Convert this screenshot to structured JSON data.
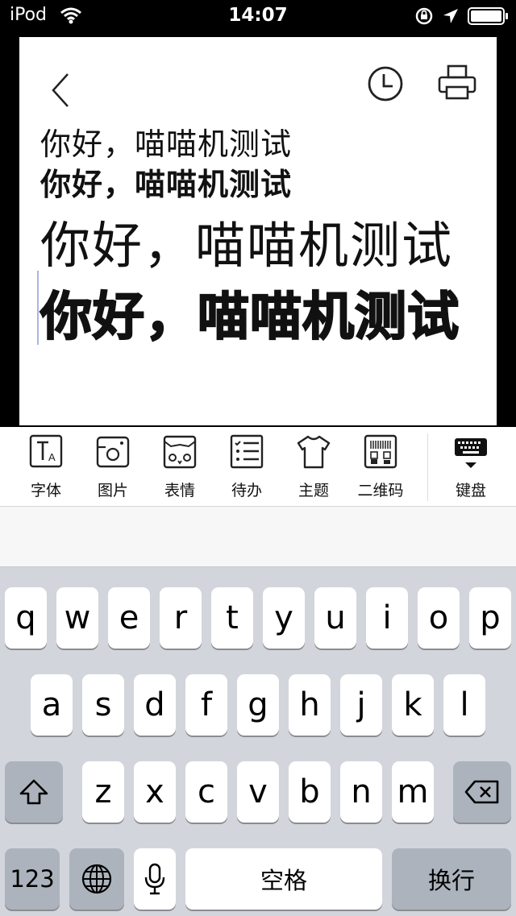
{
  "status_bar": {
    "carrier": "iPod",
    "time": "14:07"
  },
  "note": {
    "lines": [
      "你好，喵喵机测试",
      "你好，喵喵机测试",
      "你好，喵喵机测试",
      "你好，喵喵机测试"
    ]
  },
  "toolbar": {
    "items": [
      {
        "label": "字体",
        "icon": "font-icon"
      },
      {
        "label": "图片",
        "icon": "image-icon"
      },
      {
        "label": "表情",
        "icon": "emoji-cat-icon"
      },
      {
        "label": "待办",
        "icon": "todo-list-icon"
      },
      {
        "label": "主题",
        "icon": "tshirt-theme-icon"
      },
      {
        "label": "二维码",
        "icon": "qrcode-icon"
      },
      {
        "label": "键盘",
        "icon": "keyboard-hide-icon"
      }
    ]
  },
  "keyboard": {
    "row1": [
      "q",
      "w",
      "e",
      "r",
      "t",
      "y",
      "u",
      "i",
      "o",
      "p"
    ],
    "row2": [
      "a",
      "s",
      "d",
      "f",
      "g",
      "h",
      "j",
      "k",
      "l"
    ],
    "row3": [
      "z",
      "x",
      "c",
      "v",
      "b",
      "n",
      "m"
    ],
    "numbers_label": "123",
    "space_label": "空格",
    "return_label": "换行"
  },
  "colors": {
    "accent_cursor": "#aab6e6",
    "keyboard_bg": "#d2d5db"
  }
}
